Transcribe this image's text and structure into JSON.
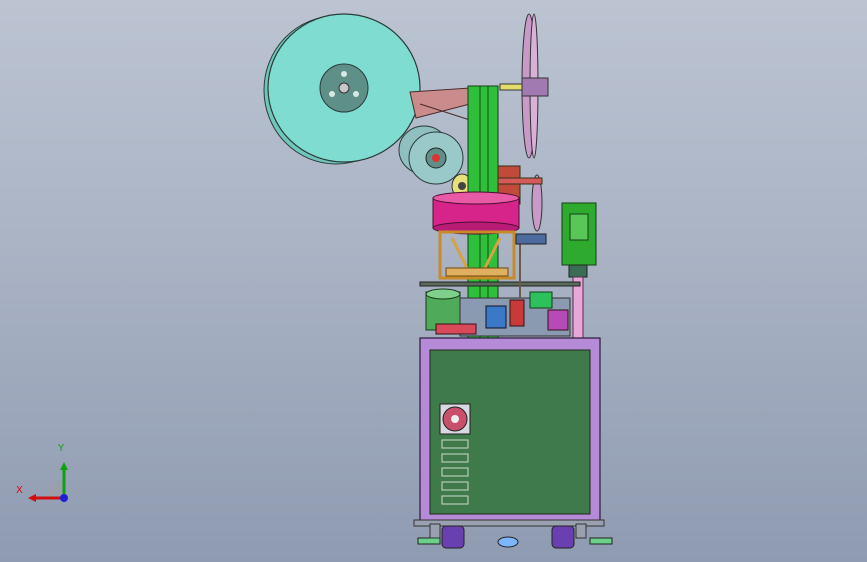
{
  "viewport": {
    "background_top": "#bcc4d2",
    "background_bottom": "#8f9bb1"
  },
  "triad": {
    "x_label": "X",
    "y_label": "Y",
    "x_color": "#d01010",
    "y_color": "#10a010",
    "z_color": "#2020d0"
  },
  "model": {
    "colors": {
      "main_reel": "#7fdcd0",
      "reel_hub": "#5e9088",
      "cabinet_frame": "#b58ad6",
      "cabinet_panel": "#3f7a4a",
      "column": "#2fbf3a",
      "ring": "#d6248a",
      "motor_housing": "#2eaa2e",
      "rod": "#e7a8d8",
      "casters": "#6a3fb0"
    },
    "icons": [
      "fan-icon",
      "vent-slot-icon",
      "caster-icon"
    ]
  }
}
